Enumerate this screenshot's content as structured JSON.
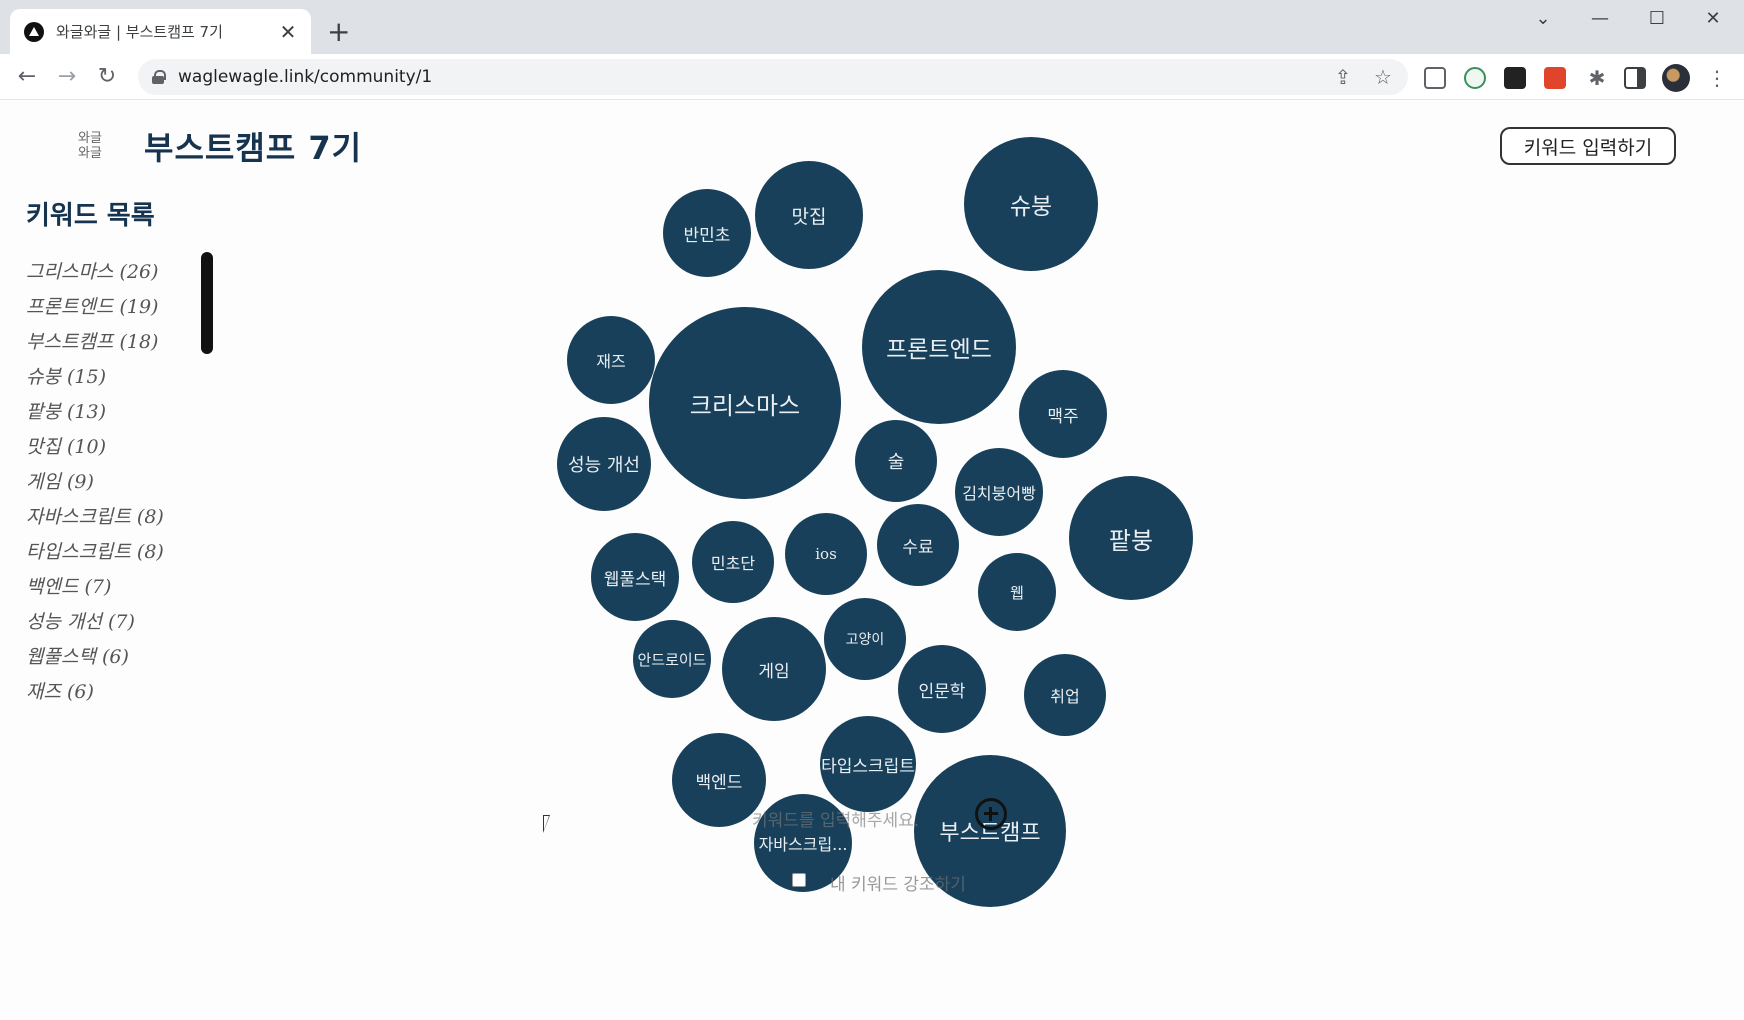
{
  "browser": {
    "tab_title": "와글와글 | 부스트캠프 7기",
    "url": "waglewagle.link/community/1"
  },
  "header": {
    "logo_text": "와글\n와글",
    "title": "부스트캠프 7기",
    "keyword_input_button": "키워드 입력하기"
  },
  "sidebar": {
    "title": "키워드 목록",
    "items": [
      "그리스마스 (26)",
      "프론트엔드 (19)",
      "부스트캠프 (18)",
      "슈붕 (15)",
      "팥붕 (13)",
      "맛집 (10)",
      "게임 (9)",
      "자바스크립트 (8)",
      "타입스크립트 (8)",
      "백엔드 (7)",
      "성능 개선 (7)",
      "웹풀스택 (6)",
      "재즈 (6)"
    ]
  },
  "bubbles": [
    {
      "label": "반민초"
    },
    {
      "label": "맛집"
    },
    {
      "label": "슈붕"
    },
    {
      "label": "재즈"
    },
    {
      "label": "크리스마스"
    },
    {
      "label": "프론트엔드"
    },
    {
      "label": "맥주"
    },
    {
      "label": "성능 개선"
    },
    {
      "label": "술"
    },
    {
      "label": "김치붕어빵"
    },
    {
      "label": "팥붕"
    },
    {
      "label": "웹풀스택"
    },
    {
      "label": "민초단"
    },
    {
      "label": "ios"
    },
    {
      "label": "수료"
    },
    {
      "label": "웹"
    },
    {
      "label": "고양이"
    },
    {
      "label": "안드로이드"
    },
    {
      "label": "게임"
    },
    {
      "label": "인문학"
    },
    {
      "label": "취업"
    },
    {
      "label": "타입스크립트"
    },
    {
      "label": "백엔드"
    },
    {
      "label": "부스트캠프"
    },
    {
      "label": "자바스크립..."
    }
  ],
  "overlay": {
    "input_placeholder": "키워드를 입력해주세요.",
    "highlight_label": "내 키워드 강조하기"
  }
}
